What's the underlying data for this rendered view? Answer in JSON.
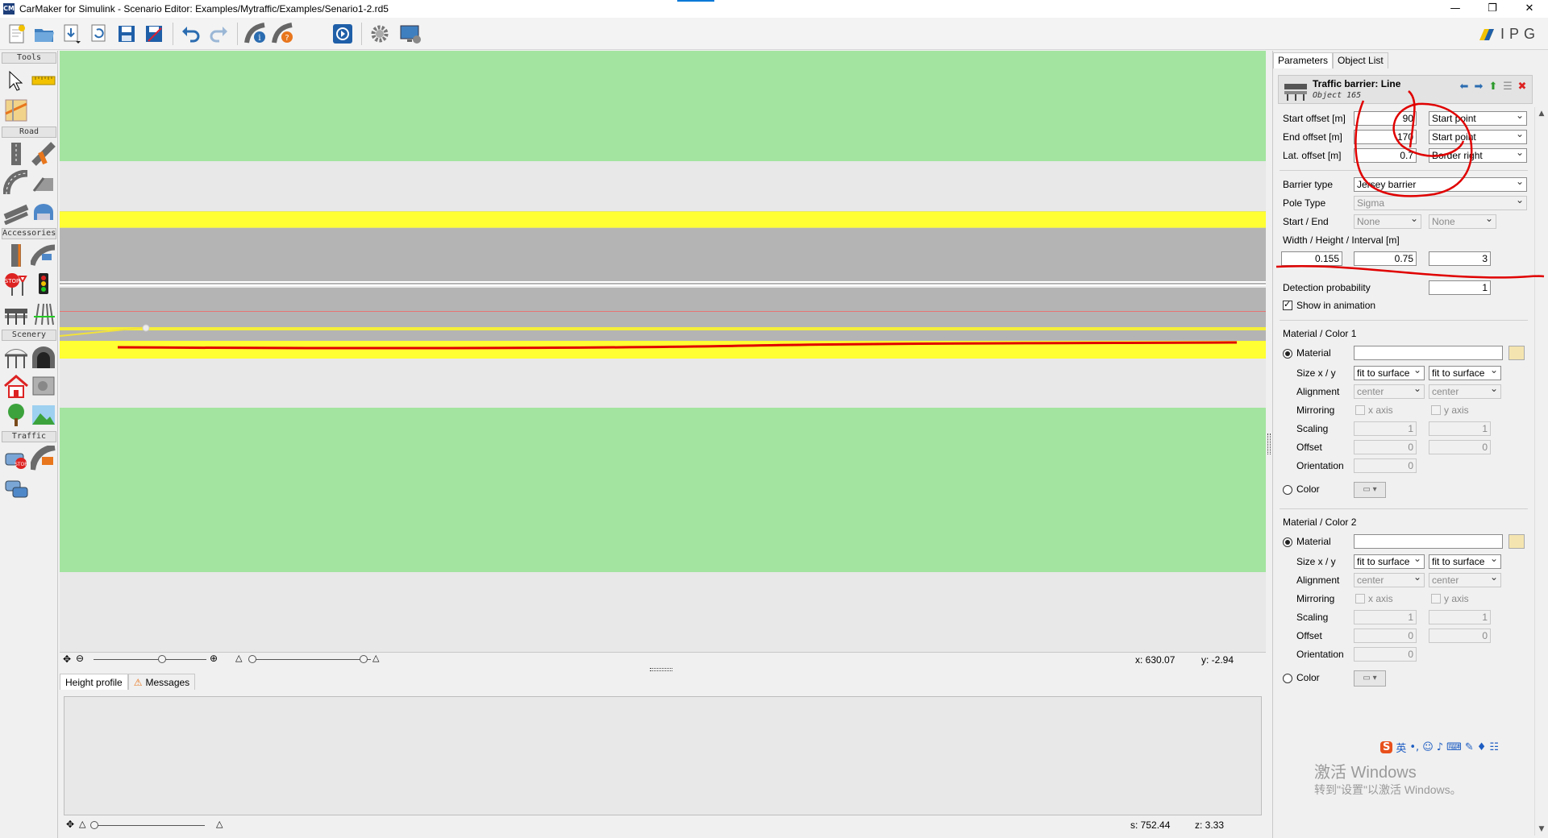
{
  "window": {
    "title": "CarMaker for Simulink - Scenario Editor: Examples/Mytraffic/Examples/Senario1-2.rd5",
    "app_icon": "CM",
    "controls": [
      "—",
      "❐",
      "✕"
    ]
  },
  "brand": {
    "logo_text": "IPG"
  },
  "palette": {
    "sections": [
      "Tools",
      "Road",
      "Accessories",
      "Scenery",
      "Traffic"
    ]
  },
  "canvas": {
    "coords": {
      "x": "x:  630.07",
      "y": "y: -2.94"
    }
  },
  "bottom": {
    "tabs": [
      "Height profile",
      "Messages"
    ],
    "status": {
      "s": "s: 752.44",
      "z": "z: 3.33"
    }
  },
  "right_panel": {
    "tabs": [
      "Parameters",
      "Object List"
    ],
    "object": {
      "title": "Traffic barrier: Line",
      "subtitle": "Object 165"
    },
    "start_offset": {
      "label": "Start offset [m]",
      "value": "90",
      "ref": "Start point"
    },
    "end_offset": {
      "label": "End offset  [m]",
      "value": "170",
      "ref": "Start point"
    },
    "lat_offset": {
      "label": "Lat. offset  [m]",
      "value": "0.7",
      "ref": "Border right"
    },
    "barrier_type": {
      "label": "Barrier type",
      "value": "Jersey barrier"
    },
    "pole_type": {
      "label": "Pole Type",
      "value": "Sigma"
    },
    "start_end": {
      "label": "Start / End",
      "start": "None",
      "end": "None"
    },
    "dims": {
      "label": "Width / Height / Interval  [m]",
      "width": "0.155",
      "height": "0.75",
      "interval": "3"
    },
    "detection": {
      "label": "Detection probability",
      "value": "1"
    },
    "show_anim": {
      "label": "Show in animation",
      "checked": true
    },
    "material1": {
      "title": "Material / Color 1",
      "material_label": "Material",
      "size_label": "Size x / y",
      "size_x": "fit to surface",
      "size_y": "fit to surface",
      "alignment_label": "Alignment",
      "align_x": "center",
      "align_y": "center",
      "mirroring_label": "Mirroring",
      "mirror_x": "x axis",
      "mirror_y": "y axis",
      "scaling_label": "Scaling",
      "scale_x": "1",
      "scale_y": "1",
      "offset_label": "Offset",
      "offset_x": "0",
      "offset_y": "0",
      "orientation_label": "Orientation",
      "orientation": "0",
      "color_label": "Color"
    },
    "material2": {
      "title": "Material / Color 2",
      "material_label": "Material",
      "size_label": "Size x / y",
      "size_x": "fit to surface",
      "size_y": "fit to surface",
      "alignment_label": "Alignment",
      "align_x": "center",
      "align_y": "center",
      "mirroring_label": "Mirroring",
      "mirror_x": "x axis",
      "mirror_y": "y axis",
      "scaling_label": "Scaling",
      "scale_x": "1",
      "scale_y": "1",
      "offset_label": "Offset",
      "offset_x": "0",
      "offset_y": "0",
      "orientation_label": "Orientation",
      "orientation": "0",
      "color_label": "Color"
    }
  },
  "windows_watermark": {
    "line1": "激活 Windows",
    "line2": "转到\"设置\"以激活 Windows。"
  },
  "ime": {
    "lang": "英"
  },
  "colors": {
    "grass": "#a3e4a0",
    "asphalt": "#b4b4b4",
    "marking_yellow": "#ffff33",
    "annotation_red": "#e00000"
  }
}
